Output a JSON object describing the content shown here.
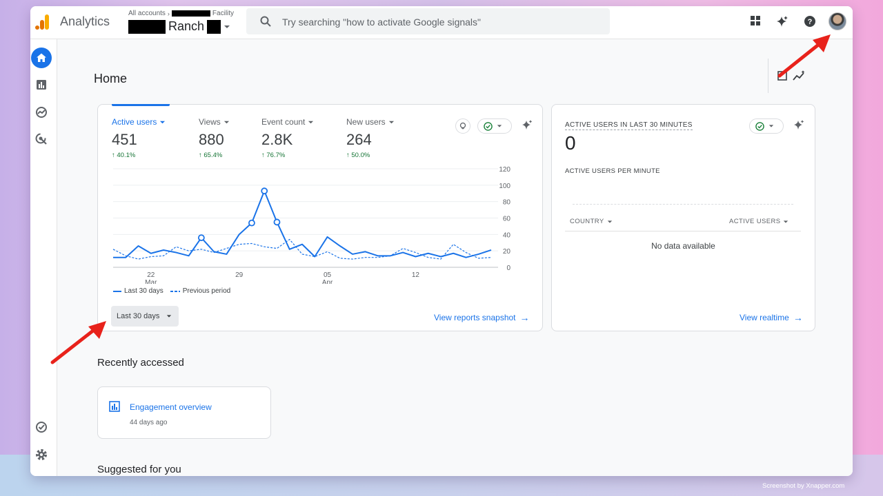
{
  "app": {
    "name": "Analytics"
  },
  "breadcrumb": {
    "all_accounts": "All accounts",
    "account_suffix": "Facility",
    "property": "Ranch"
  },
  "search": {
    "placeholder": "Try searching \"how to activate Google signals\""
  },
  "page": {
    "title": "Home"
  },
  "metrics": [
    {
      "label": "Active users",
      "value": "451",
      "delta": "40.1%",
      "active": true
    },
    {
      "label": "Views",
      "value": "880",
      "delta": "65.4%"
    },
    {
      "label": "Event count",
      "value": "2.8K",
      "delta": "76.7%"
    },
    {
      "label": "New users",
      "value": "264",
      "delta": "50.0%"
    }
  ],
  "chart_data": {
    "type": "line",
    "x": [
      "Mar 19",
      "Mar 20",
      "Mar 21",
      "Mar 22",
      "Mar 23",
      "Mar 24",
      "Mar 25",
      "Mar 26",
      "Mar 27",
      "Mar 28",
      "Mar 29",
      "Mar 30",
      "Mar 31",
      "Apr 01",
      "Apr 02",
      "Apr 03",
      "Apr 04",
      "Apr 05",
      "Apr 06",
      "Apr 07",
      "Apr 08",
      "Apr 09",
      "Apr 10",
      "Apr 11",
      "Apr 12",
      "Apr 13",
      "Apr 14",
      "Apr 15",
      "Apr 16",
      "Apr 17",
      "Apr 18",
      "Apr 19",
      "Apr 20"
    ],
    "x_ticks": [
      {
        "day": "22",
        "month": "Mar",
        "index": 3
      },
      {
        "day": "29",
        "month": "",
        "index": 10
      },
      {
        "day": "05",
        "month": "Apr",
        "index": 17
      },
      {
        "day": "12",
        "month": "",
        "index": 24
      }
    ],
    "series": [
      {
        "name": "Last 30 days",
        "style": "solid",
        "color": "#1a73e8",
        "values": [
          12,
          12,
          26,
          17,
          21,
          18,
          14,
          36,
          19,
          16,
          40,
          54,
          93,
          55,
          22,
          28,
          13,
          37,
          26,
          16,
          19,
          14,
          14,
          18,
          13,
          17,
          13,
          17,
          12,
          16,
          21
        ],
        "markers": [
          7,
          11,
          12,
          13
        ]
      },
      {
        "name": "Previous period",
        "style": "dashed",
        "color": "#1a73e8",
        "values": [
          22,
          14,
          10,
          13,
          14,
          25,
          20,
          22,
          18,
          23,
          28,
          29,
          25,
          23,
          34,
          16,
          13,
          19,
          11,
          10,
          12,
          12,
          14,
          23,
          18,
          12,
          10,
          28,
          18,
          11,
          12
        ]
      }
    ],
    "yticks": [
      0,
      20,
      40,
      60,
      80,
      100,
      120
    ],
    "ylim": [
      0,
      120
    ],
    "grid": true,
    "legend": "bottom-left"
  },
  "card1": {
    "date_range": "Last 30 days",
    "link": "View reports snapshot"
  },
  "realtime": {
    "title": "ACTIVE USERS IN LAST 30 MINUTES",
    "value": "0",
    "subtitle": "ACTIVE USERS PER MINUTE",
    "col_country": "COUNTRY",
    "col_users": "ACTIVE USERS",
    "empty": "No data available",
    "link": "View realtime"
  },
  "recent": {
    "title": "Recently accessed",
    "items": [
      {
        "title": "Engagement overview",
        "subtitle": "44 days ago"
      }
    ]
  },
  "suggested": {
    "title": "Suggested for you"
  },
  "watermark": "Screenshot by Xnapper.com"
}
